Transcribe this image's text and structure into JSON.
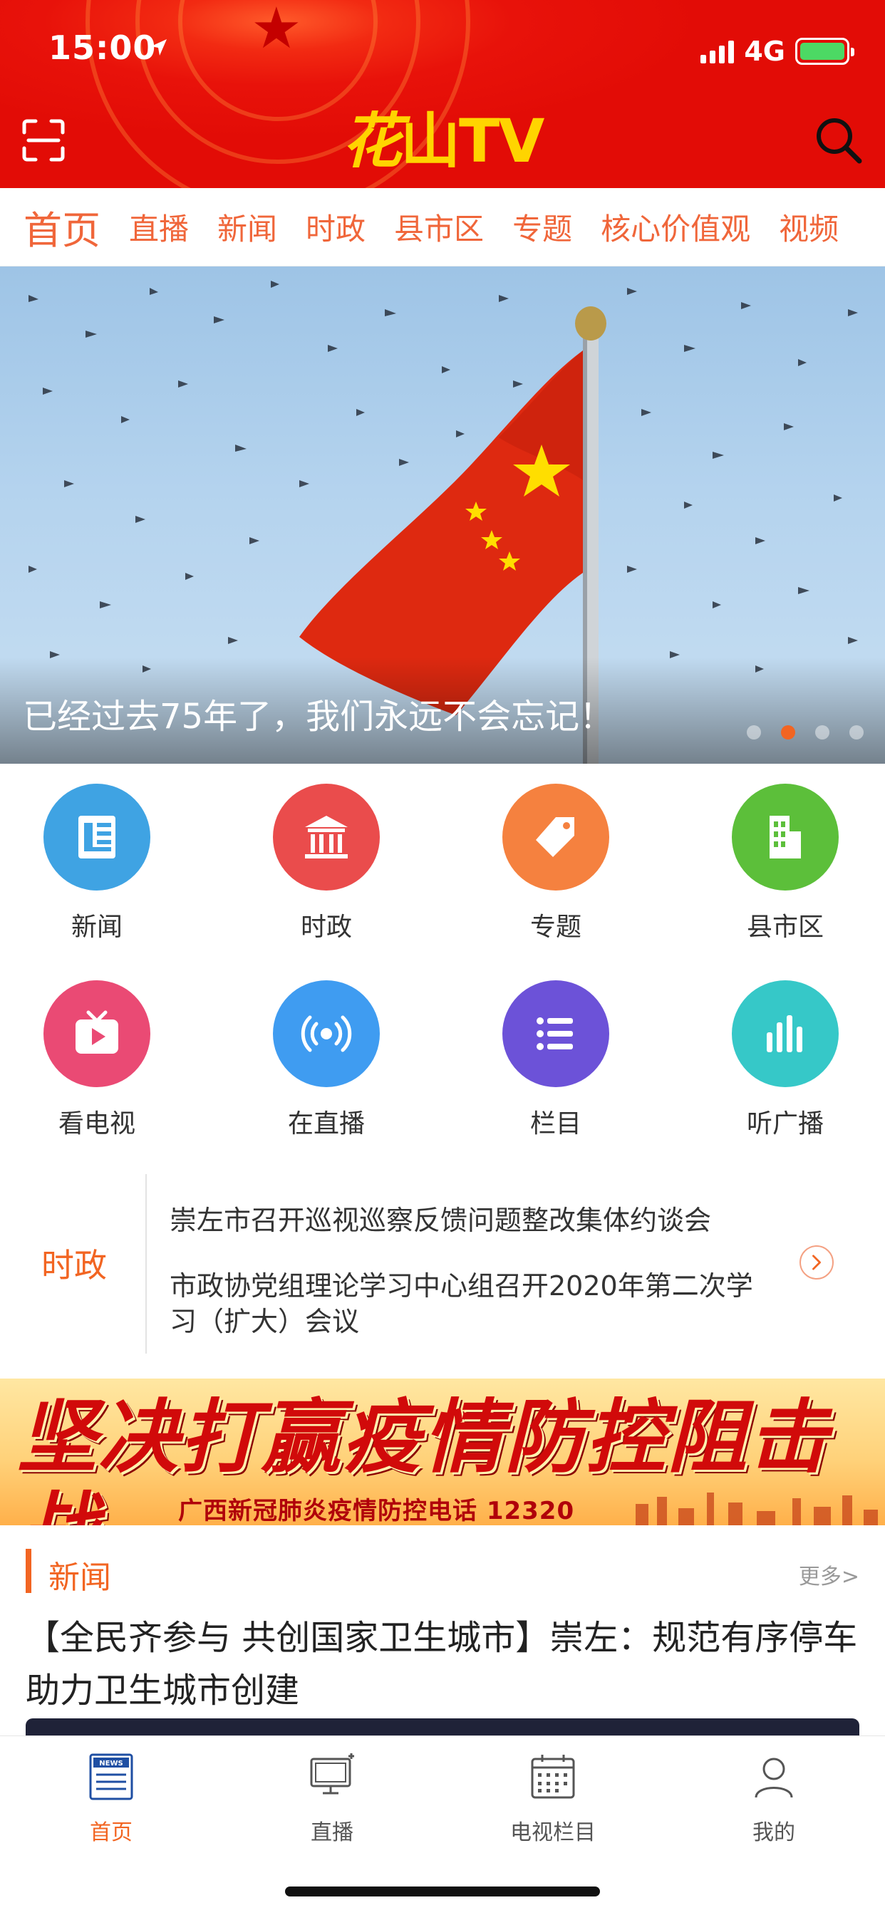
{
  "status_bar": {
    "time": "15:00",
    "network": "4G"
  },
  "header": {
    "brand_part1": "花",
    "brand_part2": "山TV"
  },
  "tabs": [
    "首页",
    "直播",
    "新闻",
    "时政",
    "县市区",
    "专题",
    "核心价值观",
    "视频"
  ],
  "banner": {
    "caption": "已经过去75年了，我们永远不会忘记！",
    "slides": 4,
    "active_slide": 2
  },
  "grid": [
    {
      "label": "新闻",
      "icon": "news-icon",
      "color": "#3fa3e3"
    },
    {
      "label": "时政",
      "icon": "government-icon",
      "color": "#ea4c4c"
    },
    {
      "label": "专题",
      "icon": "tag-icon",
      "color": "#f5813f"
    },
    {
      "label": "县市区",
      "icon": "building-icon",
      "color": "#5cbf3a"
    },
    {
      "label": "看电视",
      "icon": "tv-icon",
      "color": "#ea4a74"
    },
    {
      "label": "在直播",
      "icon": "broadcast-icon",
      "color": "#3f9cf1"
    },
    {
      "label": "栏目",
      "icon": "list-icon",
      "color": "#6c52d8"
    },
    {
      "label": "听广播",
      "icon": "bars-icon",
      "color": "#36c8c8"
    }
  ],
  "ticker": {
    "label": "时政",
    "items": [
      "崇左市召开巡视巡察反馈问题整改集体约谈会",
      "市政协党组理论学习中心组召开2020年第二次学习（扩大）会议"
    ]
  },
  "epidemic_banner": {
    "title": "坚决打赢疫情防控阻击战",
    "subtitle": "广西新冠肺炎疫情防控电话 12320"
  },
  "news_section": {
    "title": "新闻",
    "more": "更多>",
    "headline": "【全民齐参与 共创国家卫生城市】崇左：规范有序停车 助力卫生城市创建"
  },
  "bottom_nav": [
    {
      "label": "首页",
      "icon": "news-icon",
      "active": true
    },
    {
      "label": "直播",
      "icon": "monitor-icon",
      "active": false
    },
    {
      "label": "电视栏目",
      "icon": "calendar-icon",
      "active": false
    },
    {
      "label": "我的",
      "icon": "user-icon",
      "active": false
    }
  ],
  "colors": {
    "accent": "#f26522",
    "header_red": "#e8120a",
    "brand_yellow": "#ffd400"
  }
}
